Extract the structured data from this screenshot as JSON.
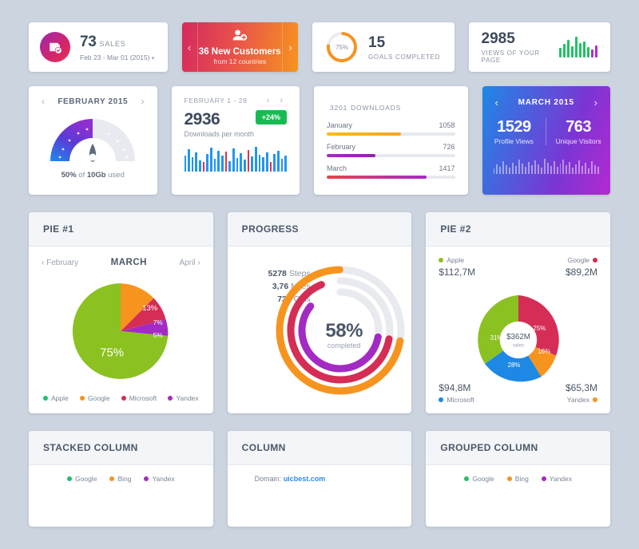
{
  "theme": {
    "background": "#ccd4df",
    "card_bg": "#ffffff",
    "header_bg": "#f3f5f9",
    "text_dark": "#3d4a5c",
    "text_muted": "#8a93a4",
    "green": "#8bc121",
    "orange": "#f7941e",
    "crimson": "#d52d55",
    "purple": "#a32bc4",
    "blue": "#1e88e5",
    "amber": "#fbbd08",
    "badge_green": "#18bb52",
    "link_blue": "#2d8cf0"
  },
  "row1": {
    "sales": {
      "icon": "sale-tag-check-icon",
      "value": "73",
      "label": "SALES",
      "date_range": "Feb 23 - Mar 01 (2015)",
      "caret": "▾"
    },
    "customers": {
      "icon": "user-plus-icon",
      "title": "36 New Customers",
      "subtitle": "from 12 countries",
      "prev_arrow": "‹",
      "next_arrow": "›"
    },
    "goals": {
      "ring_label": "75%",
      "ring_percent": 75,
      "value": "15",
      "label": "GOALS COMPLETED"
    },
    "views": {
      "value": "2985",
      "label": "VIEWS OF YOUR PAGE",
      "spark": [
        {
          "h": 12,
          "c": "#1fc55f"
        },
        {
          "h": 17,
          "c": "#1fc55f"
        },
        {
          "h": 22,
          "c": "#1fc55f"
        },
        {
          "h": 14,
          "c": "#1fc55f"
        },
        {
          "h": 26,
          "c": "#1fc55f"
        },
        {
          "h": 18,
          "c": "#1fc55f"
        },
        {
          "h": 20,
          "c": "#1fc55f"
        },
        {
          "h": 13,
          "c": "#1fc55f"
        },
        {
          "h": 10,
          "c": "#b42ad0"
        },
        {
          "h": 15,
          "c": "#b42ad0"
        }
      ]
    }
  },
  "row2": {
    "gauge": {
      "title": "FEBRUARY 2015",
      "prev_arrow": "‹",
      "next_arrow": "›",
      "percent": 50,
      "footer_percent": "50%",
      "footer_mid": " of ",
      "footer_size": "10Gb",
      "footer_end": " used"
    },
    "downloads_month": {
      "range": "FEBRUARY 1 - 28",
      "arrows": "‹ ›",
      "value": "2936",
      "subtitle": "Downloads per month",
      "badge": "+24%",
      "bars": [
        {
          "h": 20,
          "c": "#2196f3"
        },
        {
          "h": 28,
          "c": "#2196f3"
        },
        {
          "h": 18,
          "c": "#2196f3"
        },
        {
          "h": 24,
          "c": "#2196f3"
        },
        {
          "h": 14,
          "c": "#2196f3"
        },
        {
          "h": 12,
          "c": "#e8304f"
        },
        {
          "h": 22,
          "c": "#2196f3"
        },
        {
          "h": 30,
          "c": "#2196f3"
        },
        {
          "h": 16,
          "c": "#2196f3"
        },
        {
          "h": 26,
          "c": "#2196f3"
        },
        {
          "h": 20,
          "c": "#2196f3"
        },
        {
          "h": 25,
          "c": "#e8304f"
        },
        {
          "h": 13,
          "c": "#2196f3"
        },
        {
          "h": 29,
          "c": "#2196f3"
        },
        {
          "h": 17,
          "c": "#2196f3"
        },
        {
          "h": 23,
          "c": "#2196f3"
        },
        {
          "h": 15,
          "c": "#2196f3"
        },
        {
          "h": 27,
          "c": "#e8304f"
        },
        {
          "h": 19,
          "c": "#2196f3"
        },
        {
          "h": 31,
          "c": "#2196f3"
        },
        {
          "h": 21,
          "c": "#2196f3"
        },
        {
          "h": 18,
          "c": "#2196f3"
        },
        {
          "h": 24,
          "c": "#2196f3"
        },
        {
          "h": 12,
          "c": "#e8304f"
        },
        {
          "h": 22,
          "c": "#2196f3"
        },
        {
          "h": 26,
          "c": "#2196f3"
        },
        {
          "h": 16,
          "c": "#2196f3"
        },
        {
          "h": 20,
          "c": "#2196f3"
        }
      ]
    },
    "downloads_total": {
      "value": "3201",
      "label": "DOWNLOADS",
      "rows": [
        {
          "name": "January",
          "value": "1058",
          "percent": 58,
          "fill": "linear-gradient(90deg,#fbbd08,#f5a623)"
        },
        {
          "name": "February",
          "value": "726",
          "percent": 38,
          "fill": "linear-gradient(90deg,#a32bc4,#8e24aa)"
        },
        {
          "name": "March",
          "value": "1417",
          "percent": 78,
          "fill": "linear-gradient(90deg,#e8434b,#a32bc4)"
        }
      ]
    },
    "march": {
      "title": "MARCH 2015",
      "prev_arrow": "‹",
      "next_arrow": "›",
      "stats": [
        {
          "value": "1529",
          "label": "Profile Views"
        },
        {
          "value": "763",
          "label": "Unique Visitors"
        }
      ],
      "bars": [
        7,
        12,
        9,
        16,
        11,
        8,
        14,
        10,
        18,
        13,
        9,
        15,
        11,
        17,
        12,
        8,
        19,
        14,
        10,
        16,
        9,
        13,
        18,
        11,
        15,
        8,
        12,
        17,
        10,
        14,
        7,
        16,
        11,
        9
      ]
    }
  },
  "row3": {
    "pie1": {
      "header": "PIE #1",
      "nav": {
        "prev": "February",
        "current": "MARCH",
        "next": "April",
        "prev_arrow": "‹",
        "next_arrow": "›"
      },
      "legend": [
        {
          "name": "Apple",
          "color": "#21c06b"
        },
        {
          "name": "Google",
          "color": "#f7941e"
        },
        {
          "name": "Microsoft",
          "color": "#d52d55"
        },
        {
          "name": "Yandex",
          "color": "#a32bc4"
        }
      ]
    },
    "progress": {
      "header": "PROGRESS",
      "rings": [
        {
          "value": "5278",
          "unit": "Steps",
          "color": "#f7941e",
          "percent": 72
        },
        {
          "value": "3,76",
          "unit": "Miles",
          "color": "#d52d55",
          "percent": 66
        },
        {
          "value": "736",
          "unit": "Cals",
          "color": "#a32bc4",
          "percent": 58
        }
      ],
      "center_value": "58%",
      "center_label": "completed"
    },
    "pie2": {
      "header": "PIE #2",
      "center_value": "$362M",
      "center_label": "sales",
      "corners": [
        {
          "name": "Apple",
          "amount": "$112,7M",
          "color": "#8bc121",
          "pos": "tl"
        },
        {
          "name": "Google",
          "amount": "$89,2M",
          "color": "#d52d55",
          "pos": "tr"
        },
        {
          "name": "Microsoft",
          "amount": "$94,8M",
          "color": "#1e88e5",
          "pos": "bl"
        },
        {
          "name": "Yandex",
          "amount": "$65,3M",
          "color": "#f7941e",
          "pos": "br"
        }
      ]
    }
  },
  "row4": {
    "stacked": {
      "header": "STACKED COLUMN",
      "legend": [
        {
          "name": "Google",
          "color": "#21c06b"
        },
        {
          "name": "Bing",
          "color": "#f7941e"
        },
        {
          "name": "Yandex",
          "color": "#a32bc4"
        }
      ]
    },
    "column": {
      "header": "COLUMN",
      "domain_label": "Domain: ",
      "domain_link": "uicbest.com"
    },
    "grouped": {
      "header": "GROUPED COLUMN",
      "legend": [
        {
          "name": "Google",
          "color": "#21c06b"
        },
        {
          "name": "Bing",
          "color": "#f7941e"
        },
        {
          "name": "Yandex",
          "color": "#a32bc4"
        }
      ]
    }
  },
  "chart_data": [
    {
      "type": "pie",
      "title": "PIE #1",
      "period": "MARCH",
      "categories": [
        "Apple",
        "Google",
        "Microsoft",
        "Yandex"
      ],
      "values": [
        75,
        13,
        7,
        5
      ],
      "labels": [
        "75%",
        "13%",
        "7%",
        "5%"
      ],
      "colors": [
        "#8bc121",
        "#f7941e",
        "#d52d55",
        "#a32bc4"
      ],
      "legend": "bottom"
    },
    {
      "type": "pie",
      "title": "PIE #2",
      "subtype": "donut",
      "center_label": "$362M sales",
      "categories": [
        "Apple",
        "Google",
        "Yandex",
        "Microsoft"
      ],
      "values": [
        31,
        25,
        16,
        28
      ],
      "labels": [
        "31%",
        "25%",
        "16%",
        "28%"
      ],
      "amounts": [
        "$112,7M",
        "$89,2M",
        "$65,3M",
        "$94,8M"
      ],
      "colors": [
        "#8bc121",
        "#d52d55",
        "#f7941e",
        "#1e88e5"
      ],
      "legend": "corners"
    },
    {
      "type": "bar",
      "title": "PROGRESS",
      "subtype": "radial",
      "categories": [
        "Steps",
        "Miles",
        "Cals"
      ],
      "values": [
        5278,
        3.76,
        736
      ],
      "value_labels": [
        "5278",
        "3,76",
        "736"
      ],
      "percents": [
        72,
        66,
        58
      ],
      "colors": [
        "#f7941e",
        "#d52d55",
        "#a32bc4"
      ],
      "center": "58% completed"
    },
    {
      "type": "bar",
      "title": "3201 DOWNLOADS",
      "categories": [
        "January",
        "February",
        "March"
      ],
      "values": [
        1058,
        726,
        1417
      ],
      "percents": [
        58,
        38,
        78
      ],
      "colors": [
        "#fbbd08",
        "#a32bc4",
        "#e8434b"
      ],
      "orientation": "horizontal"
    },
    {
      "type": "bar",
      "title": "Downloads per month",
      "subtitle": "FEBRUARY 1 - 28",
      "total": 2936,
      "change": "+24%",
      "colors": [
        "#2196f3",
        "#e8304f"
      ]
    },
    {
      "type": "bar",
      "title": "VIEWS OF YOUR PAGE",
      "total": 2985,
      "values": [
        12,
        17,
        22,
        14,
        26,
        18,
        20,
        13,
        10,
        15
      ],
      "colors": [
        "#1fc55f",
        "#b42ad0"
      ]
    },
    {
      "type": "pie",
      "subtype": "gauge",
      "title": "FEBRUARY 2015",
      "values": [
        50,
        50
      ],
      "labels": [
        "50% of 10Gb used",
        ""
      ],
      "colors": [
        "#5b3ad6",
        "#e6e9ef"
      ]
    },
    {
      "type": "pie",
      "subtype": "ring",
      "title": "GOALS COMPLETED",
      "values": [
        75,
        25
      ],
      "labels": [
        "75%",
        ""
      ],
      "total": 15,
      "colors": [
        "#f7941e",
        "#ececf0"
      ]
    },
    {
      "type": "bar",
      "title": "MARCH 2015",
      "series": [
        {
          "name": "Profile Views",
          "value": 1529
        },
        {
          "name": "Unique Visitors",
          "value": 763
        }
      ]
    }
  ]
}
